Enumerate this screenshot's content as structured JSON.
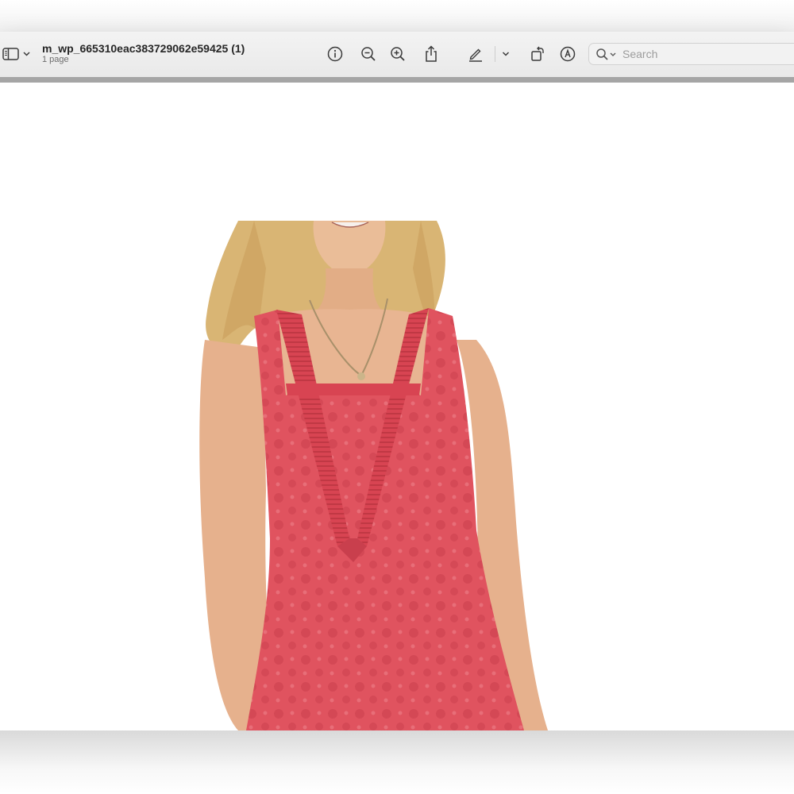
{
  "document": {
    "title": "m_wp_665310eac383729062e59425 (1)",
    "page_count": "1 page"
  },
  "toolbar": {
    "buttons": [
      {
        "name": "sidebar-toggle",
        "icon": "sidebar-icon"
      },
      {
        "name": "info-button",
        "icon": "info-icon"
      },
      {
        "name": "zoom-out-button",
        "icon": "zoom-out-icon"
      },
      {
        "name": "zoom-in-button",
        "icon": "zoom-in-icon"
      },
      {
        "name": "share-button",
        "icon": "share-icon"
      },
      {
        "name": "markup-button",
        "icon": "pen-icon"
      },
      {
        "name": "markup-options-button",
        "icon": "chevron-down-icon"
      },
      {
        "name": "rotate-button",
        "icon": "rotate-icon"
      },
      {
        "name": "annotate-button",
        "icon": "markup-circle-icon"
      }
    ]
  },
  "search": {
    "placeholder": "Search"
  },
  "colors": {
    "toolbar": "#efefef",
    "icon": "#3a3a3a",
    "dress": "#e0535f",
    "hair": "#d9b574",
    "skin": "#e8b592"
  }
}
